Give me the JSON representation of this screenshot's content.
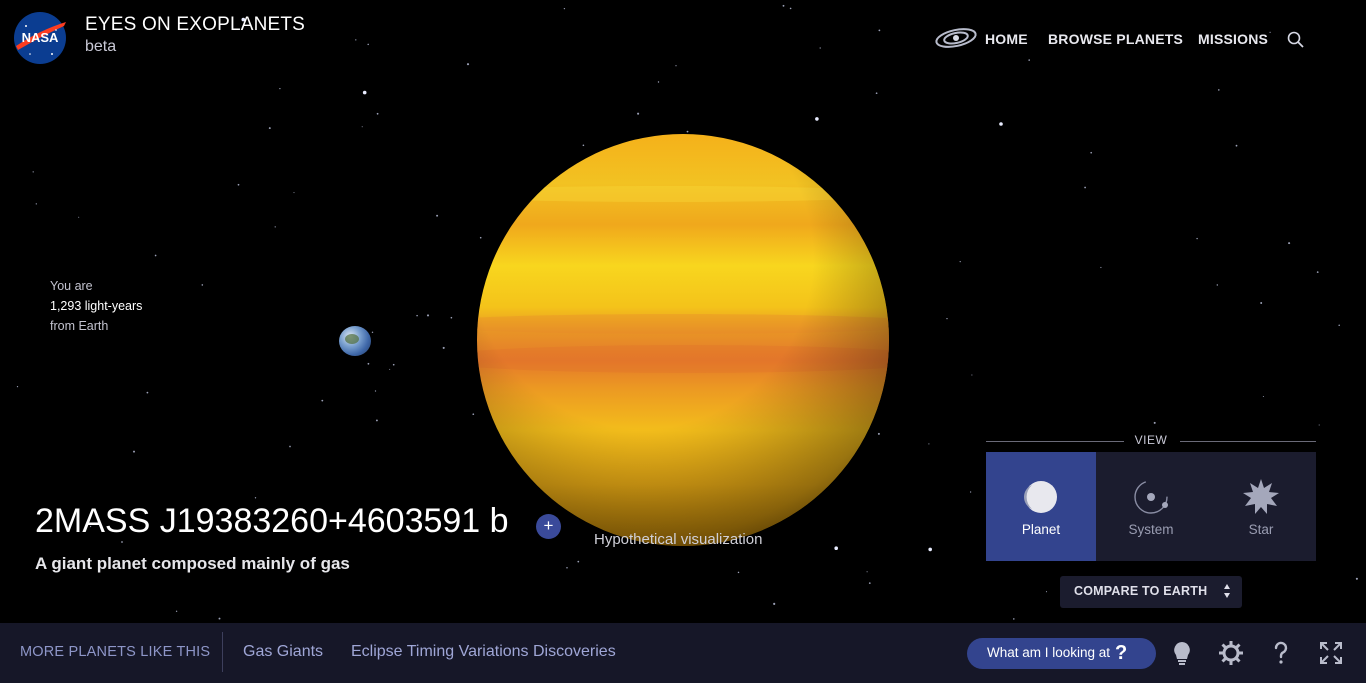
{
  "header": {
    "logo_text": "NASA",
    "app_title": "EYES ON EXOPLANETS",
    "app_subtitle": "beta",
    "nav": [
      "HOME",
      "BROWSE PLANETS",
      "MISSIONS"
    ],
    "icons": [
      "galaxy-icon",
      "search-icon"
    ]
  },
  "distance": {
    "line1": "You are",
    "line2": "1,293 light-years",
    "line3": "from Earth"
  },
  "planet": {
    "name": "2MASS J19383260+4603591 b",
    "add_label": "+",
    "description": "A giant planet composed mainly of gas",
    "visualization_note": "Hypothetical visualization"
  },
  "view": {
    "label": "VIEW",
    "buttons": [
      "Planet",
      "System",
      "Star"
    ],
    "active": "Planet",
    "compare_label": "COMPARE TO EARTH"
  },
  "bottom": {
    "more_label": "MORE PLANETS LIKE THIS",
    "tags": [
      "Gas Giants",
      "Eclipse Timing Variations Discoveries"
    ],
    "what_label": "What am I looking at",
    "what_mark": "?",
    "tools": [
      "lightbulb-icon",
      "gear-icon",
      "help-icon",
      "fullscreen-icon"
    ]
  },
  "colors": {
    "background": "#000000",
    "panel": "#1b1c2e",
    "accent": "#33448e",
    "bottom_bar": "#161728",
    "link": "#9fa6d6",
    "planet_yellow": "#f2c21a",
    "planet_orange": "#e8862a"
  }
}
